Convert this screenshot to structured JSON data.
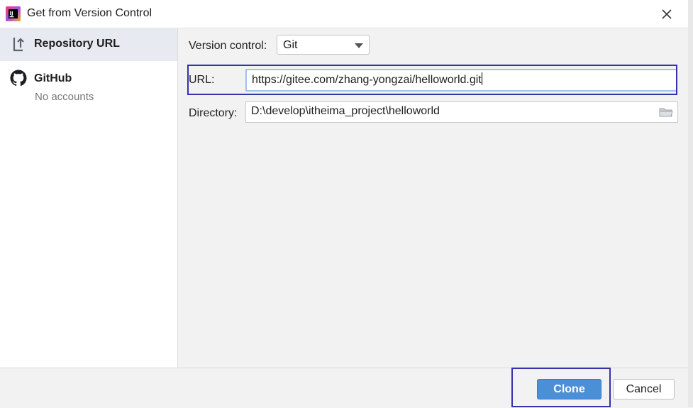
{
  "window": {
    "title": "Get from Version Control"
  },
  "sidebar": {
    "items": [
      {
        "label": "Repository URL",
        "icon": "repository-url-icon",
        "selected": true
      },
      {
        "label": "GitHub",
        "sublabel": "No accounts",
        "icon": "github-icon",
        "selected": false
      }
    ]
  },
  "form": {
    "version_control_label": "Version control:",
    "version_control_value": "Git",
    "url_label": "URL:",
    "url_value": "https://gitee.com/zhang-yongzai/helloworld.git",
    "directory_label": "Directory:",
    "directory_value": "D:\\develop\\itheima_project\\helloworld"
  },
  "footer": {
    "clone_label": "Clone",
    "cancel_label": "Cancel"
  },
  "colors": {
    "accent": "#4b8fd6",
    "highlight_border": "#3433a8",
    "selected_bg": "#e7eaf0"
  }
}
